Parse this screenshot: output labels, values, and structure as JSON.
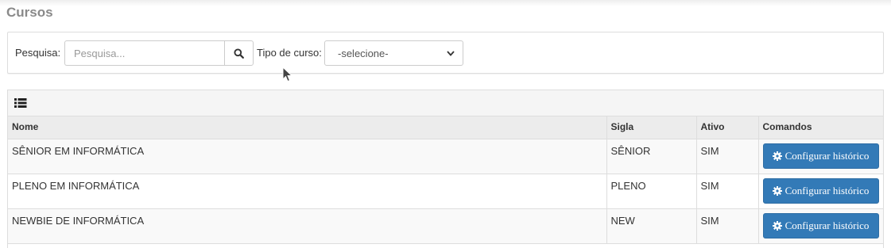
{
  "page": {
    "title": "Cursos"
  },
  "filters": {
    "search_label": "Pesquisa:",
    "search_placeholder": "Pesquisa...",
    "search_value": "",
    "search_icon": "search-icon",
    "course_type_label": "Tipo de curso:",
    "course_type_selected": "-selecione-"
  },
  "table": {
    "heading_icon": "list-icon",
    "columns": [
      "Nome",
      "Sigla",
      "Ativo",
      "Comandos"
    ],
    "rows": [
      {
        "nome": "SÊNIOR EM INFORMÁTICA",
        "sigla": "SÊNIOR",
        "ativo": "SIM",
        "command_label": "Configurar histórico"
      },
      {
        "nome": "PLENO EM INFORMÁTICA",
        "sigla": "PLENO",
        "ativo": "SIM",
        "command_label": "Configurar histórico"
      },
      {
        "nome": "NEWBIE DE INFORMÁTICA",
        "sigla": "NEW",
        "ativo": "SIM",
        "command_label": "Configurar histórico"
      }
    ],
    "command_icon": "gear-icon"
  },
  "colors": {
    "accent": "#337ab7",
    "title_gray": "#8a8a8a",
    "border": "#dddddd",
    "header_bg": "#ececec"
  }
}
